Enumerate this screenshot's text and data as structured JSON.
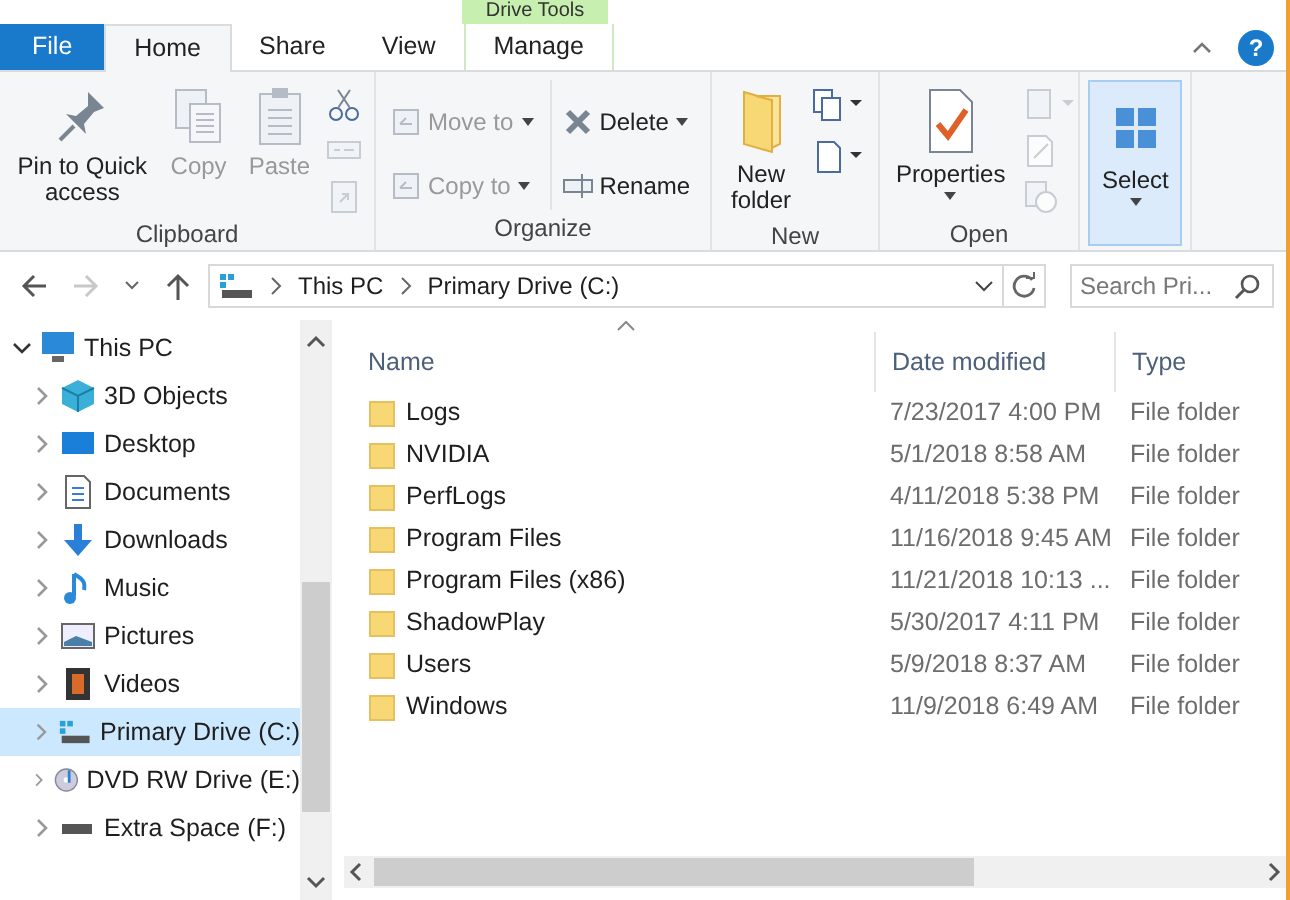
{
  "contextual_tab": {
    "label": "Drive Tools"
  },
  "tabs": [
    {
      "label": "File",
      "kind": "file",
      "selected": false
    },
    {
      "label": "Home",
      "kind": "tab",
      "selected": true
    },
    {
      "label": "Share",
      "kind": "tab",
      "selected": false
    },
    {
      "label": "View",
      "kind": "tab",
      "selected": false
    },
    {
      "label": "Manage",
      "kind": "contextual",
      "selected": false
    }
  ],
  "help": {
    "label": "?"
  },
  "ribbon_groups": [
    {
      "label": "Clipboard",
      "large": [
        {
          "label": "Pin to Quick access",
          "disabled": false
        },
        {
          "label": "Copy",
          "disabled": true
        },
        {
          "label": "Paste",
          "disabled": true
        }
      ],
      "small": [
        {
          "disabled": false
        },
        {
          "disabled": true
        },
        {
          "disabled": true
        }
      ]
    },
    {
      "label": "Organize",
      "rows": [
        {
          "label": "Move to",
          "disabled": true,
          "dropdown": true
        },
        {
          "label": "Delete",
          "disabled": false,
          "dropdown": true
        },
        {
          "label": "Copy to",
          "disabled": true,
          "dropdown": true
        },
        {
          "label": "Rename",
          "disabled": false,
          "dropdown": false
        }
      ]
    },
    {
      "label": "New",
      "large": [
        {
          "label": "New folder",
          "disabled": false
        }
      ],
      "small": [
        {
          "disabled": false
        },
        {
          "disabled": false
        }
      ]
    },
    {
      "label": "Open",
      "large": [
        {
          "label": "Properties",
          "disabled": false
        }
      ],
      "small": [
        {
          "disabled": true
        },
        {
          "disabled": true
        },
        {
          "disabled": true
        }
      ]
    },
    {
      "large": [
        {
          "label": "Select",
          "disabled": false
        }
      ]
    }
  ],
  "nav": {
    "back_disabled": false,
    "forward_disabled": true
  },
  "address": {
    "crumbs": [
      "This PC",
      "Primary Drive (C:)"
    ]
  },
  "search": {
    "placeholder": "Search Pri..."
  },
  "tree": [
    {
      "label": "This PC",
      "expanded": true,
      "selected": false,
      "children": [
        {
          "label": "3D Objects",
          "expanded": false,
          "selected": false
        },
        {
          "label": "Desktop",
          "expanded": false,
          "selected": false
        },
        {
          "label": "Documents",
          "expanded": false,
          "selected": false
        },
        {
          "label": "Downloads",
          "expanded": false,
          "selected": false
        },
        {
          "label": "Music",
          "expanded": false,
          "selected": false
        },
        {
          "label": "Pictures",
          "expanded": false,
          "selected": false
        },
        {
          "label": "Videos",
          "expanded": false,
          "selected": false
        },
        {
          "label": "Primary Drive (C:)",
          "expanded": false,
          "selected": true
        },
        {
          "label": "DVD RW Drive (E:)",
          "expanded": false,
          "selected": false
        },
        {
          "label": "Extra Space (F:)",
          "expanded": false,
          "selected": false
        }
      ]
    }
  ],
  "table": {
    "columns": [
      "Name",
      "Date modified",
      "Type"
    ],
    "rows": [
      {
        "name": "Logs",
        "date": "7/23/2017 4:00 PM",
        "type": "File folder"
      },
      {
        "name": "NVIDIA",
        "date": "5/1/2018 8:58 AM",
        "type": "File folder"
      },
      {
        "name": "PerfLogs",
        "date": "4/11/2018 5:38 PM",
        "type": "File folder"
      },
      {
        "name": "Program Files",
        "date": "11/16/2018 9:45 AM",
        "type": "File folder"
      },
      {
        "name": "Program Files (x86)",
        "date": "11/21/2018 10:13 ...",
        "type": "File folder"
      },
      {
        "name": "ShadowPlay",
        "date": "5/30/2017 4:11 PM",
        "type": "File folder"
      },
      {
        "name": "Users",
        "date": "5/9/2018 8:37 AM",
        "type": "File folder"
      },
      {
        "name": "Windows",
        "date": "11/9/2018 6:49 AM",
        "type": "File folder"
      }
    ]
  }
}
